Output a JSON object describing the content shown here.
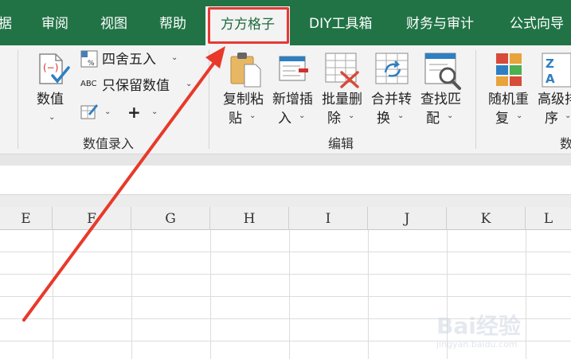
{
  "tabs": [
    {
      "label": "据"
    },
    {
      "label": "审阅"
    },
    {
      "label": "视图"
    },
    {
      "label": "帮助"
    },
    {
      "label": "方方格子",
      "active": true
    },
    {
      "label": "DIY工具箱"
    },
    {
      "label": "财务与审计"
    },
    {
      "label": "公式向导"
    }
  ],
  "ribbon": {
    "numeric_group": {
      "label": "数值录入",
      "value_button": {
        "line1": "数值"
      },
      "round_button": {
        "label": "四舍五入"
      },
      "keep_button": {
        "icon_text": "ABC",
        "label": "只保留数值"
      },
      "plus_button": {
        "label": "+"
      }
    },
    "edit_group": {
      "label": "编辑",
      "copy_paste": {
        "line1": "复制粘",
        "line2": "贴"
      },
      "insert": {
        "line1": "新增插",
        "line2": "入"
      },
      "delete": {
        "line1": "批量删",
        "line2": "除"
      },
      "merge": {
        "line1": "合并转",
        "line2": "换"
      },
      "find": {
        "line1": "查找匹",
        "line2": "配"
      }
    },
    "data_group": {
      "label": "数",
      "shuffle": {
        "line1": "随机重",
        "line2": "复"
      },
      "sort": {
        "line1": "高级排",
        "line2": "序"
      }
    }
  },
  "columns": [
    "E",
    "F",
    "G",
    "H",
    "I",
    "J",
    "K",
    "L"
  ],
  "colors": {
    "tab_bar": "#217346",
    "highlight": "#e53935",
    "arrow": "#e8392a"
  },
  "watermark": {
    "logo": "Bai经验",
    "sub": "jingyan.baidu.com"
  }
}
